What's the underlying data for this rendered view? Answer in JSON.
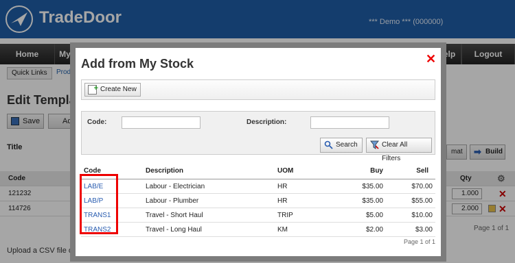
{
  "app": {
    "title": "TradeDoor",
    "demo_label": "*** Demo *** (000000)"
  },
  "nav": {
    "items": [
      "Home",
      "My",
      "elp",
      "Logout"
    ]
  },
  "subnav": {
    "quick_links": "Quick Links",
    "products": "Produ"
  },
  "page": {
    "title": "Edit Templa",
    "save": "Save",
    "add": "Add",
    "title_label": "Title",
    "format": "mat",
    "build": "Build",
    "table_headers": {
      "code": "Code",
      "qty": "Qty"
    },
    "rows": [
      {
        "code": "121232",
        "qty": "1.000"
      },
      {
        "code": "114726",
        "qty": "2.000"
      }
    ],
    "pager": "Page 1 of 1",
    "upload": "Upload a CSV file of"
  },
  "modal": {
    "title": "Add from My Stock",
    "close": "✕",
    "create_new": "Create New",
    "filters": {
      "code_label": "Code:",
      "code_value": "",
      "description_label": "Description:",
      "description_value": "",
      "search": "Search",
      "clear": "Clear All Filters"
    },
    "headers": {
      "code": "Code",
      "description": "Description",
      "uom": "UOM",
      "buy": "Buy",
      "sell": "Sell"
    },
    "rows": [
      {
        "code": "LAB/E",
        "description": "Labour - Electrician",
        "uom": "HR",
        "buy": "$35.00",
        "sell": "$70.00"
      },
      {
        "code": "LAB/P",
        "description": "Labour - Plumber",
        "uom": "HR",
        "buy": "$35.00",
        "sell": "$55.00"
      },
      {
        "code": "TRANS1",
        "description": "Travel - Short Haul",
        "uom": "TRIP",
        "buy": "$5.00",
        "sell": "$10.00"
      },
      {
        "code": "TRANS2",
        "description": "Travel - Long Haul",
        "uom": "KM",
        "buy": "$2.00",
        "sell": "$3.00"
      }
    ],
    "pager": "Page 1 of 1"
  },
  "colors": {
    "brand": "#1f5fa8",
    "highlight": "#e00000",
    "link": "#2a5db0"
  }
}
